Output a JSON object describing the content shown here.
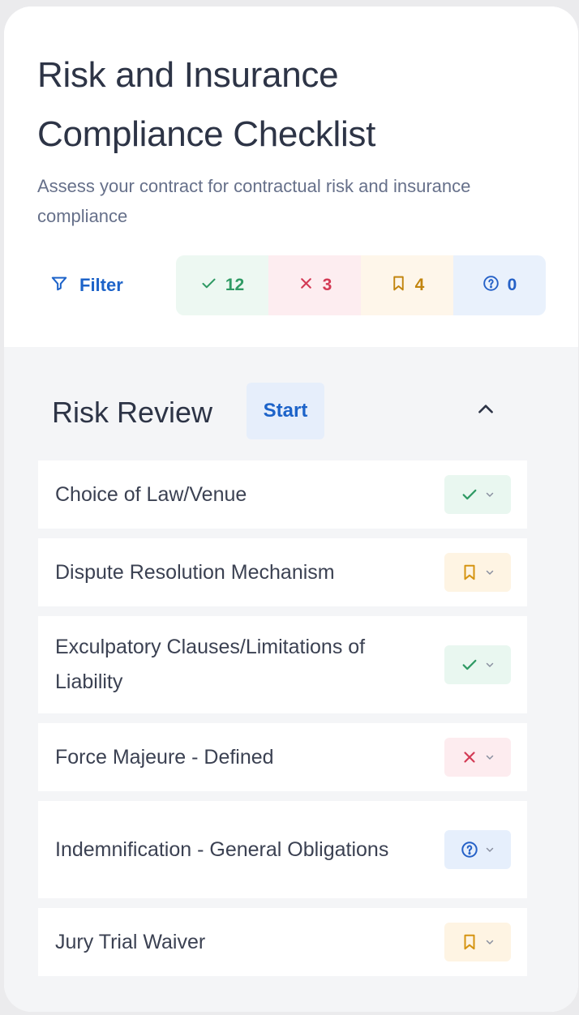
{
  "header": {
    "title": "Risk and Insurance Compliance Checklist",
    "subtitle": "Assess your contract for contractual risk and insurance compliance",
    "filter_label": "Filter",
    "counts": {
      "pass": "12",
      "fail": "3",
      "flag": "4",
      "unknown": "0"
    }
  },
  "section": {
    "title": "Risk Review",
    "start_label": "Start",
    "items": [
      {
        "label": "Choice of Law/Venue",
        "status": "pass"
      },
      {
        "label": "Dispute Resolution Mechanism",
        "status": "flag"
      },
      {
        "label": "Exculpatory Clauses/Limitations of Liability",
        "status": "pass"
      },
      {
        "label": "Force Majeure - Defined",
        "status": "fail"
      },
      {
        "label": "Indemnification - General Obligations",
        "status": "unknown"
      },
      {
        "label": "Jury Trial Waiver",
        "status": "flag"
      }
    ]
  },
  "icons": {
    "filter": "funnel-icon",
    "pass": "check-icon",
    "fail": "x-icon",
    "flag": "bookmark-icon",
    "unknown": "question-circle-icon",
    "collapse": "chevron-up-icon",
    "dropdown": "chevron-down-icon"
  },
  "colors": {
    "accent": "#1d63c9",
    "pass": "#2f9a64",
    "fail": "#d33a55",
    "flag": "#d59412",
    "unknown": "#2561c7"
  }
}
